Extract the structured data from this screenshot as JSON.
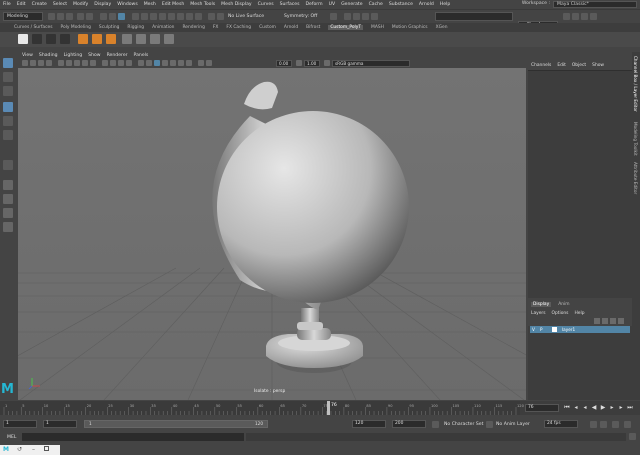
{
  "menubar": {
    "items": [
      "File",
      "Edit",
      "Create",
      "Select",
      "Modify",
      "Display",
      "Windows",
      "Mesh",
      "Edit Mesh",
      "Mesh Tools",
      "Mesh Display",
      "Curves",
      "Surfaces",
      "Deform",
      "UV",
      "Generate",
      "Cache",
      "Substance",
      "Arnold",
      "Help"
    ],
    "workspace_label": "Workspace :",
    "workspace_value": "Maya Classic*"
  },
  "statusline": {
    "mode": "Modeling",
    "live_surface": "No Live Surface",
    "symmetry": "Symmetry: Off",
    "sign_in": "Sign In"
  },
  "shelf": {
    "tabs": [
      "Curves / Surfaces",
      "Poly Modeling",
      "Sculpting",
      "Rigging",
      "Animation",
      "Rendering",
      "FX",
      "FX Caching",
      "Custom",
      "Arnold",
      "Bifrost",
      "Custom_PolyT",
      "MASH",
      "Motion Graphics",
      "XGen"
    ],
    "active_tab": "Custom_PolyT"
  },
  "viewport": {
    "menus": [
      "View",
      "Shading",
      "Lighting",
      "Show",
      "Renderer",
      "Panels"
    ],
    "exposure": "0.00",
    "gamma": "1.00",
    "color_space": "sRGB gamma",
    "camera_label": "Isolate : persp"
  },
  "channelbox": {
    "menus": [
      "Channels",
      "Edit",
      "Object",
      "Show"
    ]
  },
  "layers": {
    "tabs": [
      "Display",
      "Anim"
    ],
    "active_tab": "Display",
    "menus": [
      "Layers",
      "Options",
      "Help"
    ],
    "rows": [
      {
        "v": "V",
        "p": "P",
        "name": "layer1"
      }
    ]
  },
  "sidetabs": [
    "Channel Box / Layer Editor",
    "Modeling Toolkit",
    "Attribute Editor"
  ],
  "timeline": {
    "ticks": [
      "1",
      "5",
      "10",
      "15",
      "20",
      "25",
      "30",
      "35",
      "40",
      "45",
      "50",
      "55",
      "60",
      "65",
      "70",
      "75",
      "80",
      "85",
      "90",
      "95",
      "100",
      "105",
      "110",
      "115",
      "120"
    ],
    "current_frame": "76",
    "current_frame_field": "76"
  },
  "range": {
    "start": "1",
    "playback_start": "1",
    "slider_start": "1",
    "slider_end": "120",
    "playback_end": "120",
    "end": "200",
    "character_set": "No Character Set",
    "anim_layer": "No Anim Layer",
    "fps": "24 fps"
  },
  "cmdline": {
    "label": "MEL"
  },
  "colors": {
    "accent": "#5285a6",
    "menubg": "#444444",
    "viewport": "#6e6e6e"
  }
}
